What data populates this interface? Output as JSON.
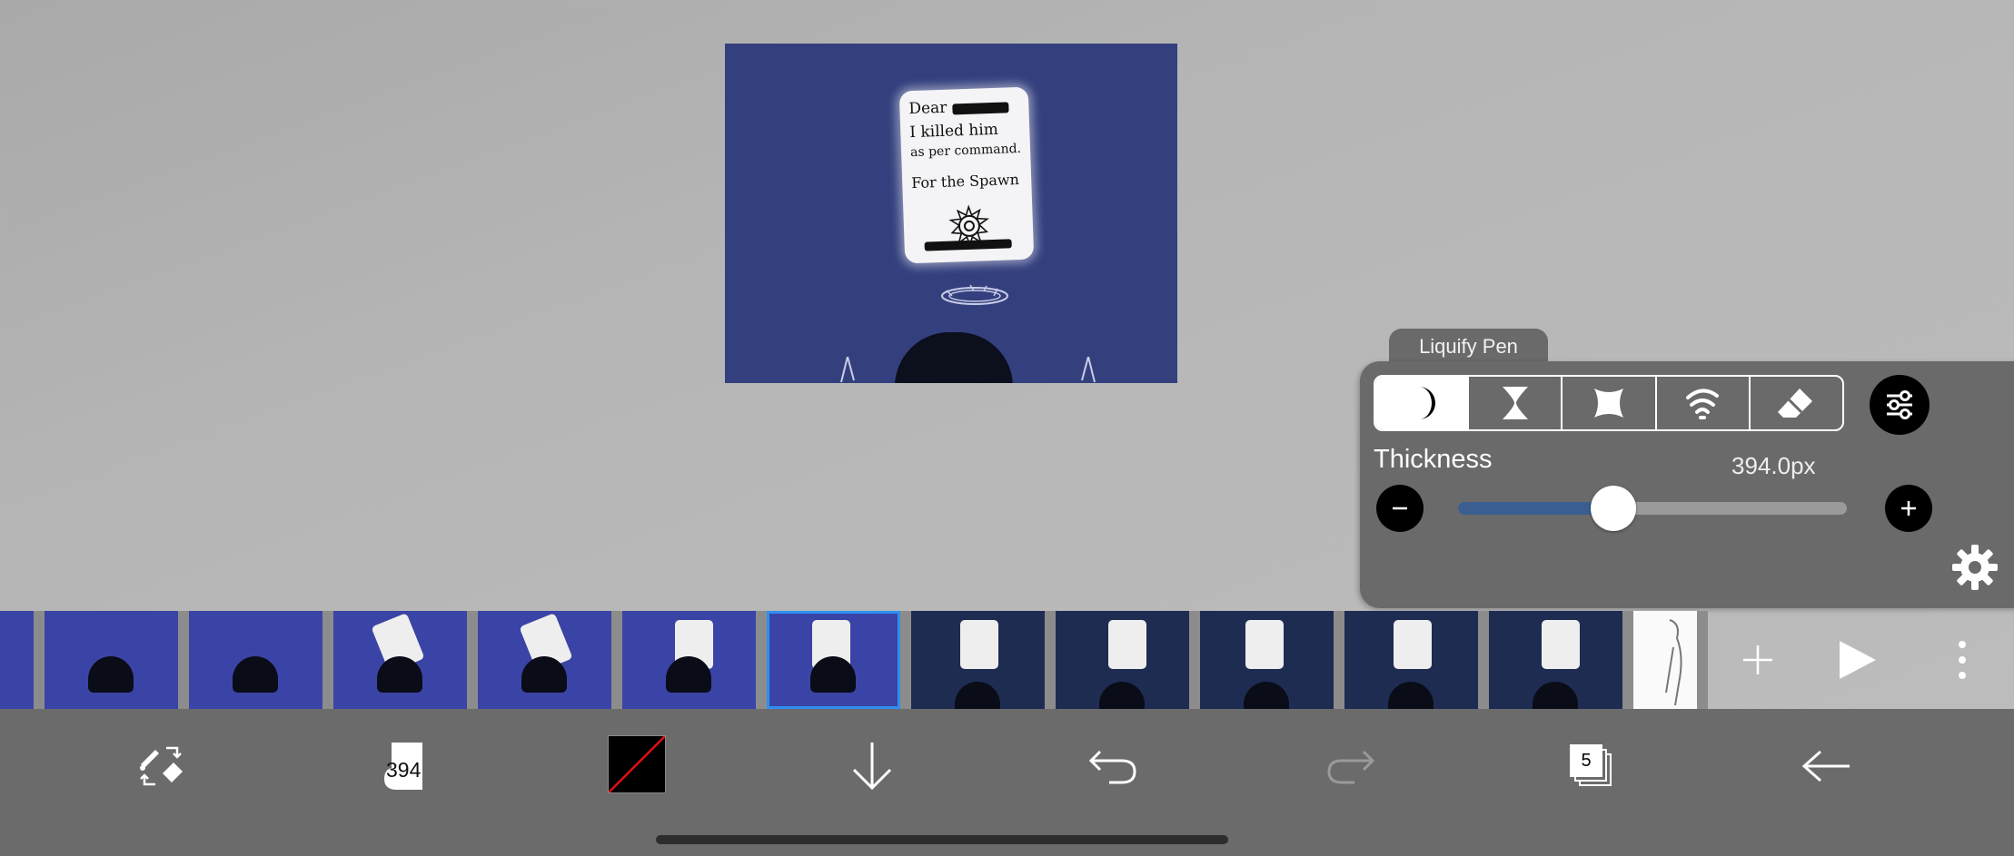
{
  "canvas": {
    "note_lines": [
      "Dear",
      "I killed him",
      "as per command.",
      "For the Spawn"
    ]
  },
  "tool_panel": {
    "tab_label": "Liquify Pen",
    "modes": [
      "push-icon",
      "pinch-icon",
      "expand-icon",
      "twirl-icon",
      "eraser-icon"
    ],
    "thickness_label": "Thickness",
    "thickness_value": "394.0px",
    "thickness_fraction": 0.4
  },
  "filmstrip": {
    "frames": [
      {
        "style": "blue"
      },
      {
        "style": "blue"
      },
      {
        "style": "blue"
      },
      {
        "style": "blue"
      },
      {
        "style": "blue"
      },
      {
        "style": "blue"
      },
      {
        "style": "blue",
        "selected": true
      },
      {
        "style": "dark"
      },
      {
        "style": "dark"
      },
      {
        "style": "dark"
      },
      {
        "style": "dark"
      },
      {
        "style": "dark"
      },
      {
        "style": "white"
      }
    ]
  },
  "bottom_bar": {
    "brush_size": "394",
    "page_count": "5"
  },
  "colors": {
    "canvas_bg": "#34407e",
    "panel_bg": "#6a6a6a",
    "slider_fill": "#3a5e8f",
    "selection": "#2f8ff0"
  }
}
